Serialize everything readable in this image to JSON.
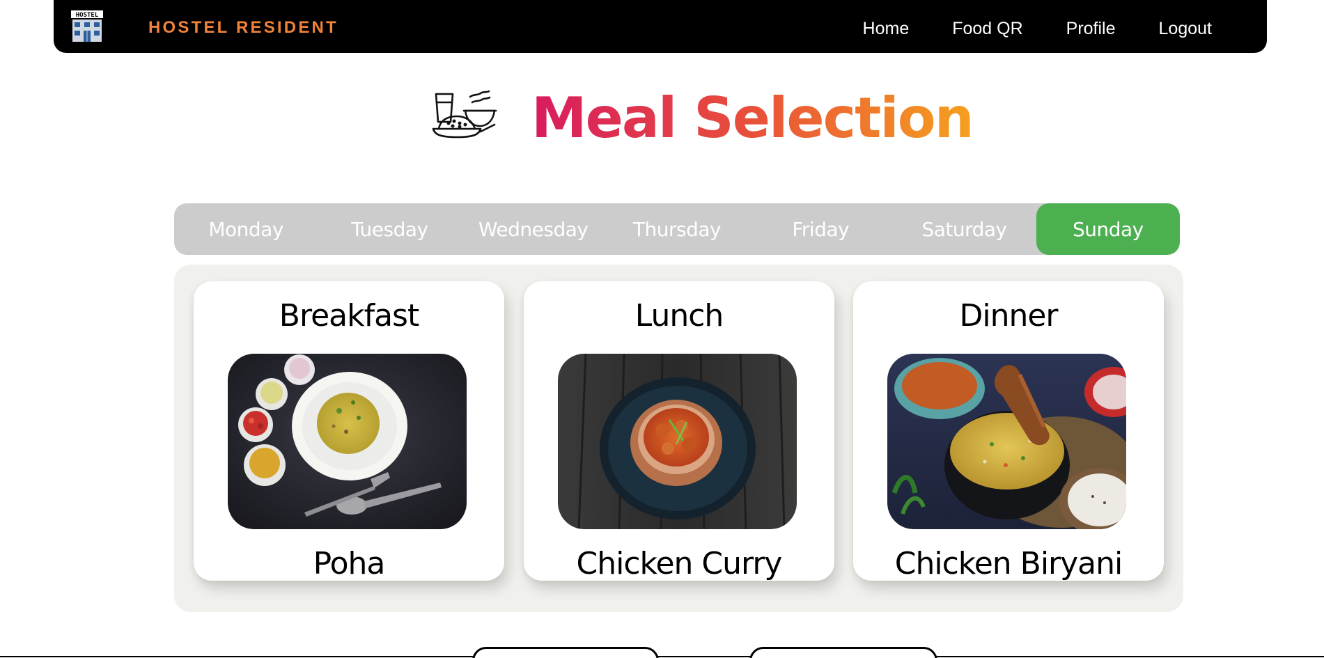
{
  "navbar": {
    "brand_logo_text": "HOSTEL",
    "brand_name": "HOSTEL RESIDENT",
    "links": [
      {
        "label": "Home"
      },
      {
        "label": "Food QR"
      },
      {
        "label": "Profile"
      },
      {
        "label": "Logout"
      }
    ]
  },
  "page": {
    "title": "Meal Selection",
    "icon": "meal-tray-icon"
  },
  "days": {
    "items": [
      {
        "label": "Monday"
      },
      {
        "label": "Tuesday"
      },
      {
        "label": "Wednesday"
      },
      {
        "label": "Thursday"
      },
      {
        "label": "Friday"
      },
      {
        "label": "Saturday"
      },
      {
        "label": "Sunday"
      }
    ],
    "selected": "Sunday"
  },
  "meals": [
    {
      "type": "Breakfast",
      "dish": "Poha"
    },
    {
      "type": "Lunch",
      "dish": "Chicken Curry"
    },
    {
      "type": "Dinner",
      "dish": "Chicken Biryani"
    }
  ],
  "colors": {
    "navbar_bg": "#000000",
    "brand_accent": "#f0833a",
    "tab_bg": "#cccccc",
    "tab_active": "#4caf50",
    "title_gradient": [
      "#d81b60",
      "#f6a01e"
    ]
  }
}
